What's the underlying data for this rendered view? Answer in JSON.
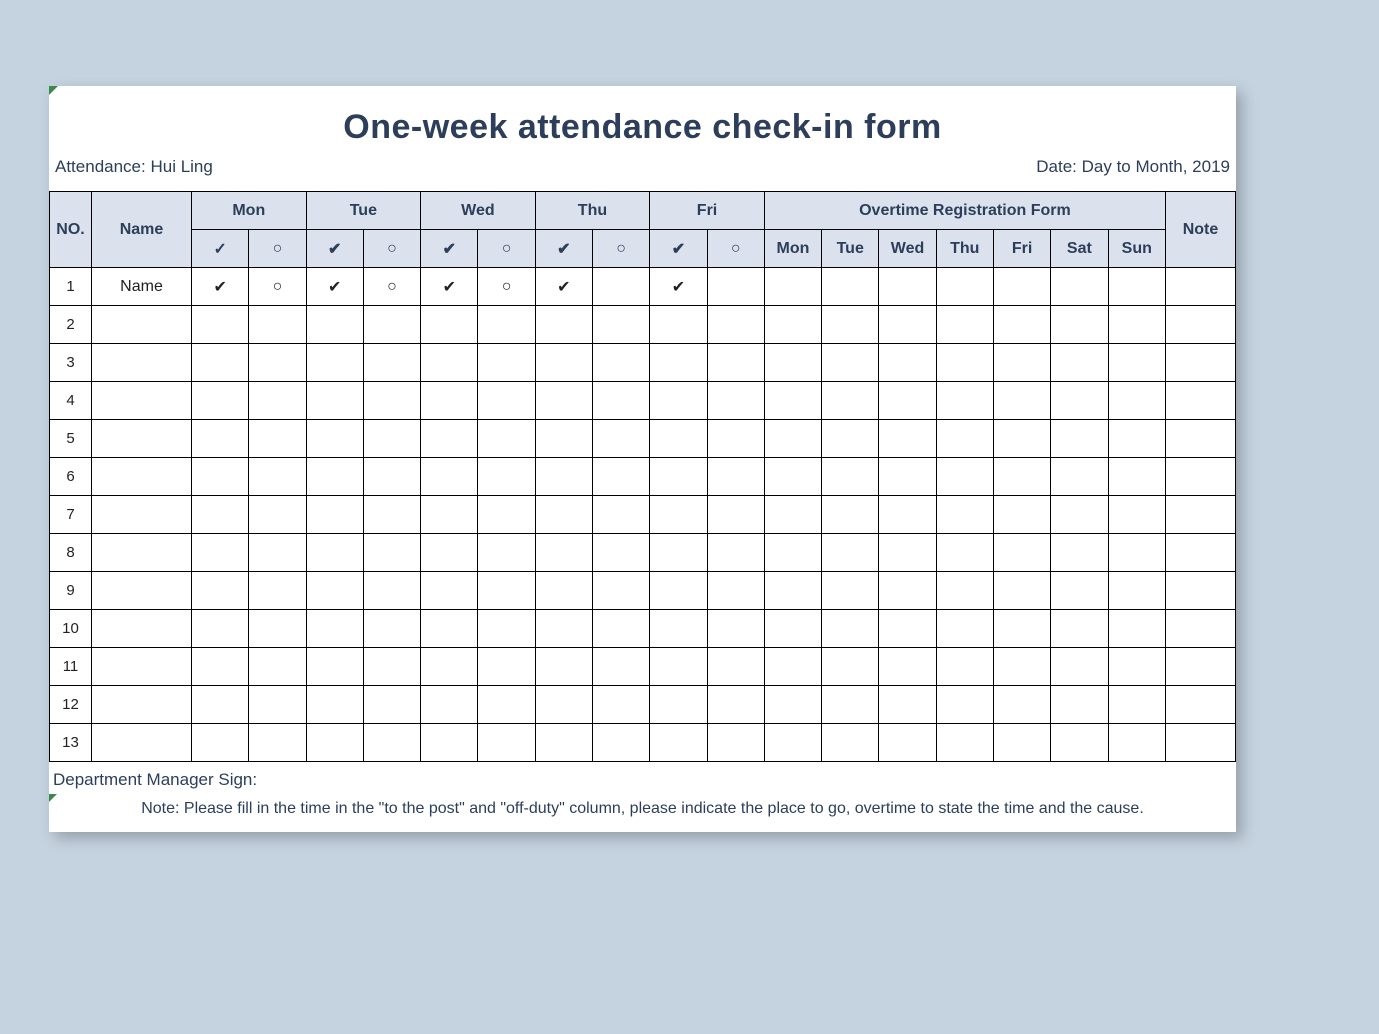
{
  "title": "One-week attendance check-in form",
  "attendance_label": "Attendance: Hui Ling",
  "date_label": "Date: Day to Month, 2019",
  "columns": {
    "no": "NO.",
    "name": "Name",
    "days": [
      "Mon",
      "Tue",
      "Wed",
      "Thu",
      "Fri"
    ],
    "overtime_title": "Overtime Registration Form",
    "overtime_days": [
      "Mon",
      "Tue",
      "Wed",
      "Thu",
      "Fri",
      "Sat",
      "Sun"
    ],
    "note": "Note",
    "check_symbol": "✓",
    "circle_symbol": "○",
    "check_heavy": "✔"
  },
  "rows": [
    {
      "no": "1",
      "name": "Name",
      "marks": [
        "✔",
        "○",
        "✔",
        "○",
        "✔",
        "○",
        "✔",
        "",
        "✔",
        ""
      ],
      "ot": [
        "",
        "",
        "",
        "",
        "",
        "",
        ""
      ],
      "note": ""
    },
    {
      "no": "2",
      "name": "",
      "marks": [
        "",
        "",
        "",
        "",
        "",
        "",
        "",
        "",
        "",
        ""
      ],
      "ot": [
        "",
        "",
        "",
        "",
        "",
        "",
        ""
      ],
      "note": ""
    },
    {
      "no": "3",
      "name": "",
      "marks": [
        "",
        "",
        "",
        "",
        "",
        "",
        "",
        "",
        "",
        ""
      ],
      "ot": [
        "",
        "",
        "",
        "",
        "",
        "",
        ""
      ],
      "note": ""
    },
    {
      "no": "4",
      "name": "",
      "marks": [
        "",
        "",
        "",
        "",
        "",
        "",
        "",
        "",
        "",
        ""
      ],
      "ot": [
        "",
        "",
        "",
        "",
        "",
        "",
        ""
      ],
      "note": ""
    },
    {
      "no": "5",
      "name": "",
      "marks": [
        "",
        "",
        "",
        "",
        "",
        "",
        "",
        "",
        "",
        ""
      ],
      "ot": [
        "",
        "",
        "",
        "",
        "",
        "",
        ""
      ],
      "note": ""
    },
    {
      "no": "6",
      "name": "",
      "marks": [
        "",
        "",
        "",
        "",
        "",
        "",
        "",
        "",
        "",
        ""
      ],
      "ot": [
        "",
        "",
        "",
        "",
        "",
        "",
        ""
      ],
      "note": ""
    },
    {
      "no": "7",
      "name": "",
      "marks": [
        "",
        "",
        "",
        "",
        "",
        "",
        "",
        "",
        "",
        ""
      ],
      "ot": [
        "",
        "",
        "",
        "",
        "",
        "",
        ""
      ],
      "note": ""
    },
    {
      "no": "8",
      "name": "",
      "marks": [
        "",
        "",
        "",
        "",
        "",
        "",
        "",
        "",
        "",
        ""
      ],
      "ot": [
        "",
        "",
        "",
        "",
        "",
        "",
        ""
      ],
      "note": ""
    },
    {
      "no": "9",
      "name": "",
      "marks": [
        "",
        "",
        "",
        "",
        "",
        "",
        "",
        "",
        "",
        ""
      ],
      "ot": [
        "",
        "",
        "",
        "",
        "",
        "",
        ""
      ],
      "note": ""
    },
    {
      "no": "10",
      "name": "",
      "marks": [
        "",
        "",
        "",
        "",
        "",
        "",
        "",
        "",
        "",
        ""
      ],
      "ot": [
        "",
        "",
        "",
        "",
        "",
        "",
        ""
      ],
      "note": ""
    },
    {
      "no": "11",
      "name": "",
      "marks": [
        "",
        "",
        "",
        "",
        "",
        "",
        "",
        "",
        "",
        ""
      ],
      "ot": [
        "",
        "",
        "",
        "",
        "",
        "",
        ""
      ],
      "note": ""
    },
    {
      "no": "12",
      "name": "",
      "marks": [
        "",
        "",
        "",
        "",
        "",
        "",
        "",
        "",
        "",
        ""
      ],
      "ot": [
        "",
        "",
        "",
        "",
        "",
        "",
        ""
      ],
      "note": ""
    },
    {
      "no": "13",
      "name": "",
      "marks": [
        "",
        "",
        "",
        "",
        "",
        "",
        "",
        "",
        "",
        ""
      ],
      "ot": [
        "",
        "",
        "",
        "",
        "",
        "",
        ""
      ],
      "note": ""
    }
  ],
  "department_sign": "Department Manager Sign:",
  "footer_note": "Note: Please fill in the time in the \"to the post\" and \"off-duty\" column, please indicate the place to go, overtime to state the time and the cause."
}
